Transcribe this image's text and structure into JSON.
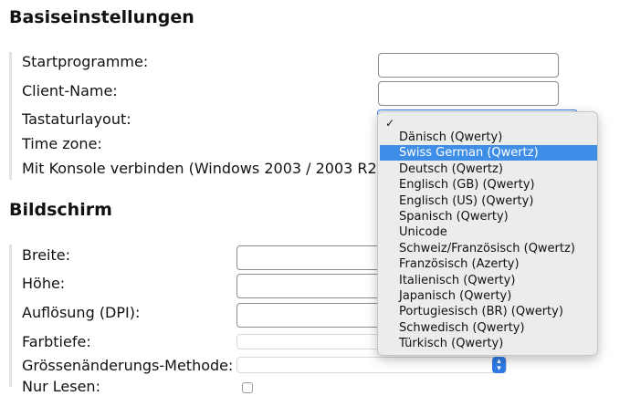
{
  "sections": {
    "basic": {
      "title": "Basiseinstellungen",
      "labels": {
        "start_program": "Startprogramme:",
        "client_name": "Client-Name:",
        "keyboard_layout": "Tastaturlayout:",
        "time_zone": "Time zone:",
        "console": "Mit Konsole verbinden (Windows 2003 / 2003 R2):"
      }
    },
    "screen": {
      "title": "Bildschirm",
      "labels": {
        "width": "Breite:",
        "height": "Höhe:",
        "resolution": "Auflösung (DPI):",
        "color_depth": "Farbtiefe:",
        "resize_method": "Grössenänderungs-Methode:",
        "read_only": "Nur Lesen:"
      }
    }
  },
  "keyboard_dropdown": {
    "selected_index": 1,
    "options": [
      "Dänisch (Qwerty)",
      "Swiss German (Qwertz)",
      "Deutsch (Qwertz)",
      "Englisch (GB) (Qwerty)",
      "Englisch (US) (Qwerty)",
      "Spanisch (Qwerty)",
      "Unicode",
      "Schweiz/Französisch (Qwertz)",
      "Französisch (Azerty)",
      "Italienisch (Qwerty)",
      "Japanisch (Qwerty)",
      "Portugiesisch (BR) (Qwerty)",
      "Schwedisch (Qwerty)",
      "Türkisch (Qwerty)"
    ],
    "check_glyph": "✓"
  },
  "colors": {
    "accent": "#3e8ee8",
    "stepper": "#2f7be6"
  }
}
